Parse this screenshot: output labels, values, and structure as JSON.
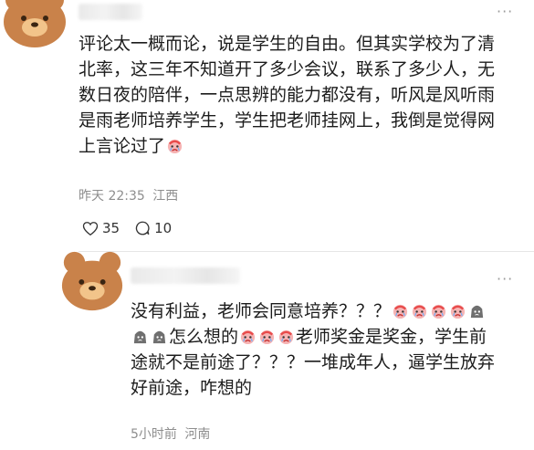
{
  "comment1": {
    "lines": [
      "评论太一概而论，说是学生的自由。但其实学校为了清",
      "北率，这三年不知道开了多少会议，联系了多少人，无",
      "数日夜的陪伴，一点思辨的能力都没有，听风是风听雨",
      "是雨老师培养学生，学生把老师挂网上，我倒是觉得网"
    ],
    "last_line": "上言论过了",
    "time": "昨天 22:35",
    "location": "江西",
    "likes": "35",
    "replies": "10",
    "more_icon": "ellipsis-icon"
  },
  "comment2": {
    "line1": "没有利益，老师会同意培养？？？",
    "line2_end": "怎么想的",
    "line2_tail": "老师奖金是奖金，学生前",
    "line3": "途就不是前途了？？？一堆成年人，逼学生放弃",
    "line4": "好前途，咋想的",
    "time": "5小时前",
    "location": "河南",
    "more_icon": "ellipsis-icon"
  },
  "colors": {
    "avatar_fill": "#c9824a",
    "avatar_face": "#f2c48a",
    "meta_text": "#8e8e8e",
    "emoji_red": "#e84b4b"
  }
}
